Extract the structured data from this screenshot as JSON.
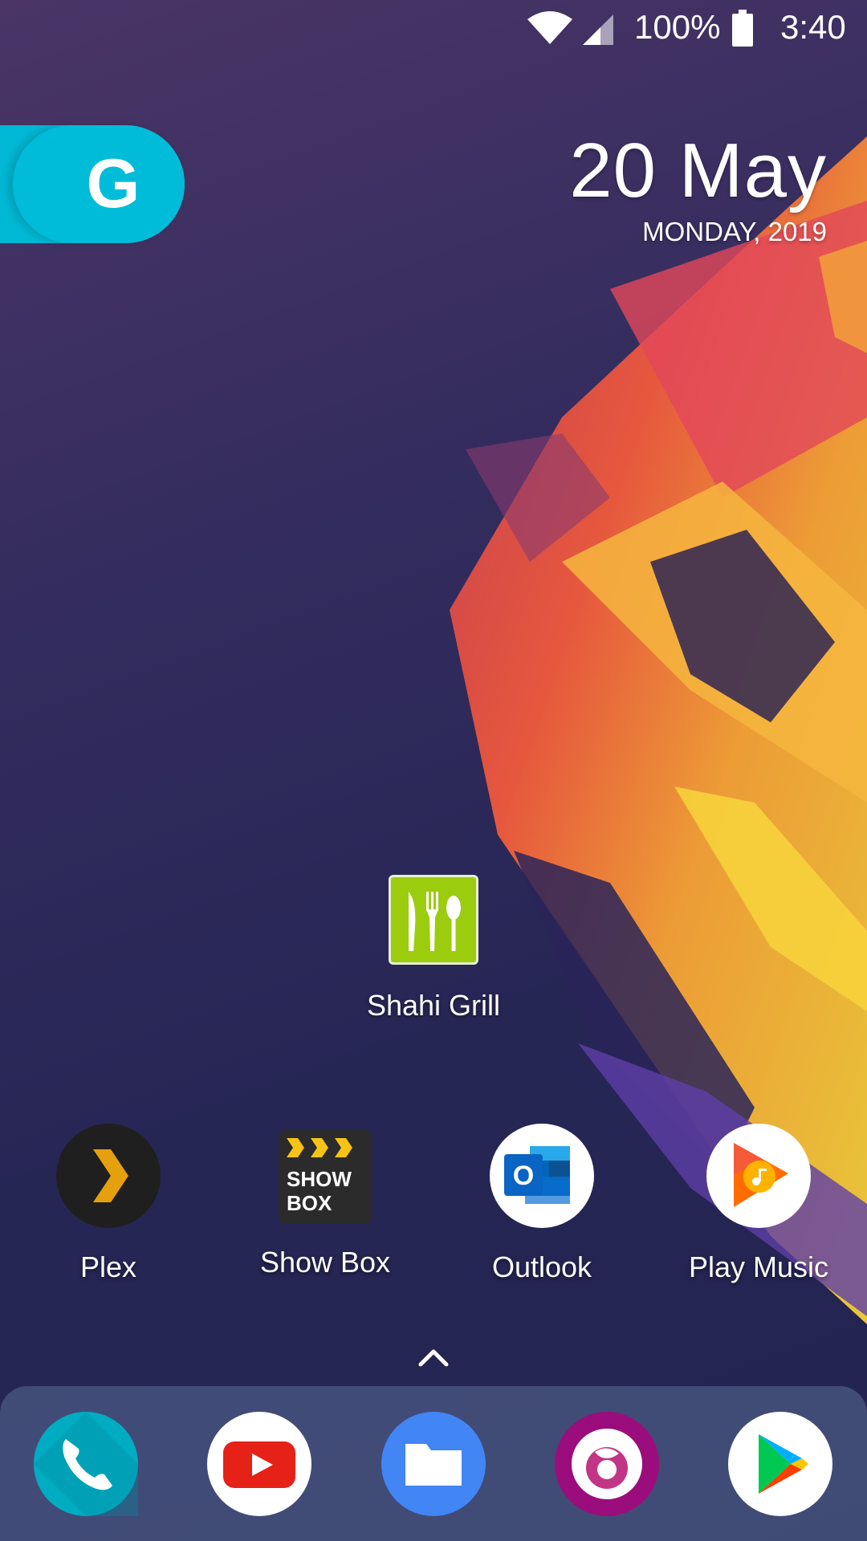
{
  "status_bar": {
    "battery_percent": "100%",
    "time": "3:40",
    "icons": [
      "wifi-icon",
      "cell-signal-icon",
      "battery-icon"
    ]
  },
  "search_widget": {
    "letter": "G",
    "color": "#00bcd8"
  },
  "date_widget": {
    "date": "20 May",
    "weekday_year": "MONDAY, 2019"
  },
  "home_apps": [
    {
      "label": "Shahi Grill",
      "icon": "utensils-icon",
      "color": "#9ccc0e"
    }
  ],
  "app_row": [
    {
      "label": "Plex",
      "icon": "plex-chevron-icon",
      "color": "#1f1f1f"
    },
    {
      "label": "Show Box",
      "icon": "showbox-icon",
      "color": "#2b2b2b"
    },
    {
      "label": "Outlook",
      "icon": "outlook-icon",
      "color": "#0a6fd1"
    },
    {
      "label": "Play Music",
      "icon": "play-music-icon",
      "color": "#ff6d00"
    }
  ],
  "showbox_icon_text": [
    "SHOW",
    "BOX"
  ],
  "outlook_icon_letter": "O",
  "drawer_handle": {
    "icon": "chevron-up-icon"
  },
  "dock": [
    {
      "icon": "phone-icon",
      "color": "#00acc1"
    },
    {
      "icon": "youtube-icon",
      "color": "#e62117"
    },
    {
      "icon": "files-icon",
      "color": "#4285f4"
    },
    {
      "icon": "firefox-focus-icon",
      "color": "#9b0d7c"
    },
    {
      "icon": "play-store-icon",
      "color": "#00c853"
    }
  ]
}
